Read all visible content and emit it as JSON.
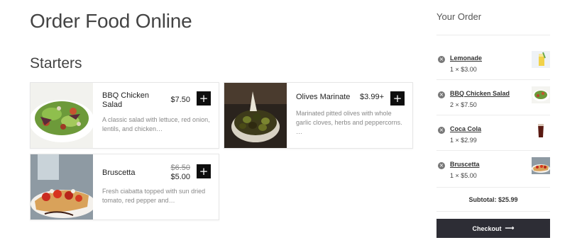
{
  "page_title": "Order Food Online",
  "section_title": "Starters",
  "menu": [
    {
      "name": "BBQ Chicken Salad",
      "price": "$7.50",
      "description": "A classic salad with lettuce, red onion, lentils, and chicken…",
      "add_label": "+"
    },
    {
      "name": "Olives Marinate",
      "price": "$3.99+",
      "description": "Marinated pitted olives with whole garlic cloves, herbs and peppercorns. …",
      "add_label": "+"
    },
    {
      "name": "Bruscetta",
      "old_price": "$6.50",
      "price": "$5.00",
      "description": "Fresh ciabatta topped with sun dried tomato, red pepper and…",
      "add_label": "+"
    }
  ],
  "order": {
    "title": "Your Order",
    "remove_icon": "×",
    "items": [
      {
        "name": "Lemonade",
        "qty": "1 × $3.00",
        "icon": "lemonade-icon"
      },
      {
        "name": "BBQ Chicken Salad",
        "qty": "2 × $7.50",
        "icon": "salad-icon"
      },
      {
        "name": "Coca Cola",
        "qty": "1 × $2.99",
        "icon": "cola-icon"
      },
      {
        "name": "Bruscetta",
        "qty": "1 × $5.00",
        "icon": "bruscetta-icon"
      }
    ],
    "subtotal_label": "Subtotal:",
    "subtotal_value": "$25.99",
    "checkout_label": "Checkout",
    "checkout_arrow": "⟶"
  },
  "colors": {
    "button_dark": "#0e0e0e",
    "checkout_bg": "#2d2d35",
    "muted_text": "#888888"
  }
}
